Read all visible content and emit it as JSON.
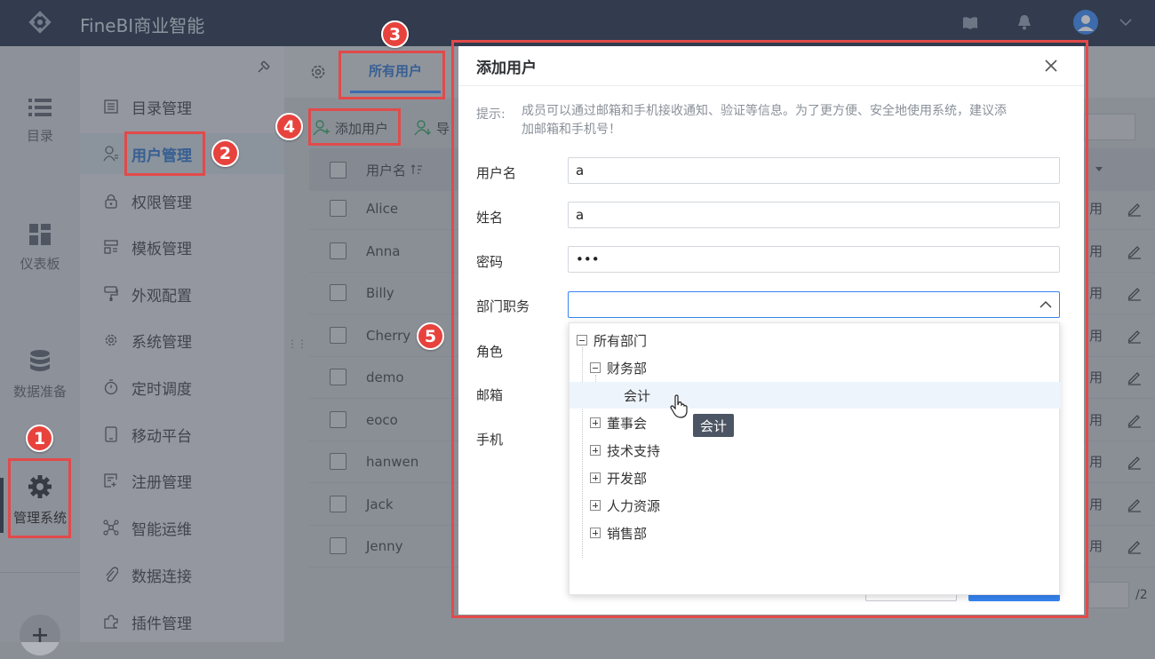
{
  "app": {
    "title": "FineBI商业智能"
  },
  "rail": {
    "items": [
      {
        "label": "目录"
      },
      {
        "label": "仪表板"
      },
      {
        "label": "数据准备"
      },
      {
        "label": "管理系统"
      }
    ],
    "add_icon": "plus-icon"
  },
  "menu": {
    "items": [
      {
        "label": "目录管理",
        "icon": "list-icon"
      },
      {
        "label": "用户管理",
        "icon": "user-icon"
      },
      {
        "label": "权限管理",
        "icon": "lock-icon"
      },
      {
        "label": "模板管理",
        "icon": "template-icon"
      },
      {
        "label": "外观配置",
        "icon": "paint-icon"
      },
      {
        "label": "系统管理",
        "icon": "gear-icon"
      },
      {
        "label": "定时调度",
        "icon": "timer-icon"
      },
      {
        "label": "移动平台",
        "icon": "mobile-icon"
      },
      {
        "label": "注册管理",
        "icon": "register-icon"
      },
      {
        "label": "智能运维",
        "icon": "ops-icon"
      },
      {
        "label": "数据连接",
        "icon": "link-icon"
      },
      {
        "label": "插件管理",
        "icon": "plugin-icon"
      }
    ]
  },
  "main": {
    "tab": "所有用户",
    "add_user": "添加用户",
    "import": "导",
    "column_username": "用户名",
    "rows": [
      "Alice",
      "Anna",
      "Billy",
      "Cherry",
      "demo",
      "eoco",
      "hanwen",
      "Jack",
      "Jenny"
    ],
    "row_tail": "用",
    "pager": "/2"
  },
  "dialog": {
    "title": "添加用户",
    "hint_label": "提示:",
    "hint_text": "成员可以通过邮箱和手机接收通知、安全地使用系统，建议添加邮箱和手机号！",
    "hint_line1": "成员可以通过邮箱和手机接收通知、验证等信息。为了更方便、安全地使用系统，建议添",
    "hint_line2": "加邮箱和手机号！",
    "fields": {
      "username": {
        "label": "用户名",
        "value": "a"
      },
      "name": {
        "label": "姓名",
        "value": "a"
      },
      "password": {
        "label": "密码",
        "value": "•••"
      },
      "dept": {
        "label": "部门职务",
        "value": ""
      },
      "role": {
        "label": "角色"
      },
      "email": {
        "label": "邮箱"
      },
      "phone": {
        "label": "手机"
      }
    }
  },
  "tree": {
    "root": "所有部门",
    "finance": "财务部",
    "accountant": "会计",
    "others": [
      "董事会",
      "技术支持",
      "开发部",
      "人力资源",
      "销售部"
    ],
    "tooltip": "会计"
  },
  "markers": [
    "1",
    "2",
    "3",
    "4",
    "5"
  ],
  "colors": {
    "accent": "#3685f2",
    "marker": "#e8423d",
    "topbar": "#223048"
  }
}
